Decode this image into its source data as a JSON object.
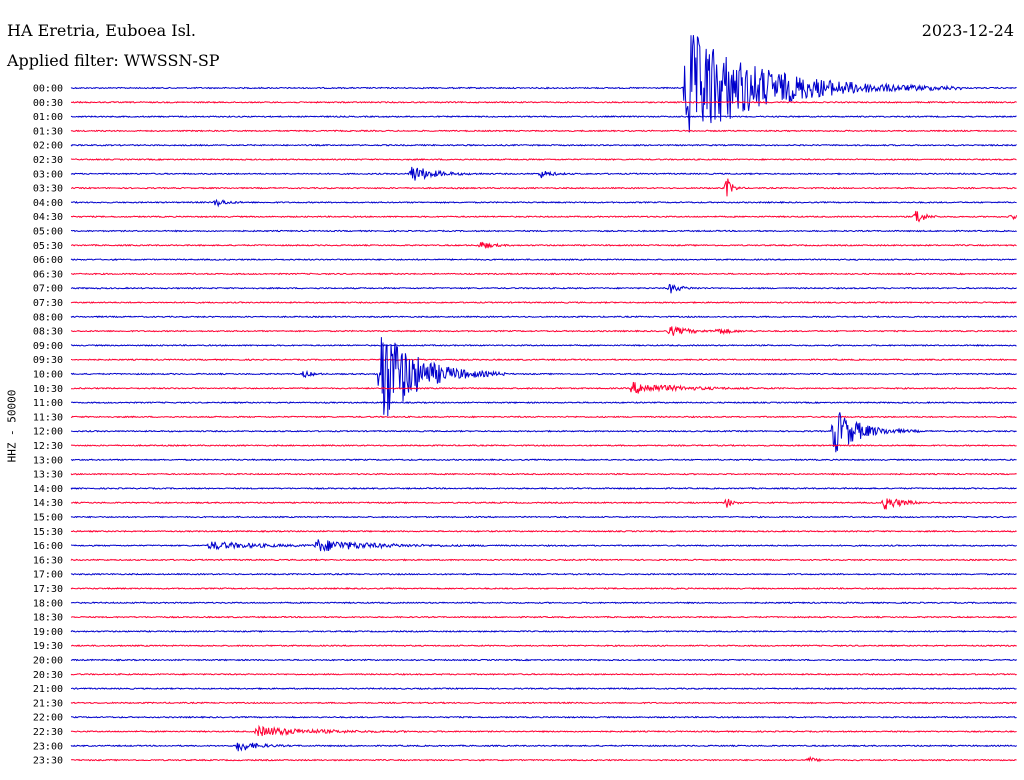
{
  "header": {
    "station": "HA Eretria, Euboea Isl.",
    "filter": "Applied filter: WWSSN-SP",
    "date": "2023-12-24"
  },
  "chart_data": {
    "type": "line",
    "ylabel": "HHZ - 50000",
    "colors": {
      "even_hour": "#0000cc",
      "half_hour": "#ff0033"
    },
    "rows": [
      "00:00",
      "00:30",
      "01:00",
      "01:30",
      "02:00",
      "02:30",
      "03:00",
      "03:30",
      "04:00",
      "04:30",
      "05:00",
      "05:30",
      "06:00",
      "06:30",
      "07:00",
      "07:30",
      "08:00",
      "08:30",
      "09:00",
      "09:30",
      "10:00",
      "10:30",
      "11:00",
      "11:30",
      "12:00",
      "12:30",
      "13:00",
      "13:30",
      "14:00",
      "14:30",
      "15:00",
      "15:30",
      "16:00",
      "16:30",
      "17:00",
      "17:30",
      "18:00",
      "18:30",
      "19:00",
      "19:30",
      "20:00",
      "20:30",
      "21:00",
      "21:30",
      "22:00",
      "22:30",
      "23:00",
      "23:30"
    ],
    "events": [
      {
        "row": 0,
        "minute": 19.5,
        "amp": 60,
        "decay": 2.2
      },
      {
        "row": 6,
        "minute": 10.8,
        "amp": 9,
        "decay": 0.6
      },
      {
        "row": 6,
        "minute": 14.9,
        "amp": 4,
        "decay": 0.3
      },
      {
        "row": 7,
        "minute": 20.8,
        "amp": 11,
        "decay": 0.15
      },
      {
        "row": 8,
        "minute": 4.6,
        "amp": 4,
        "decay": 0.3
      },
      {
        "row": 9,
        "minute": 26.8,
        "amp": 10,
        "decay": 0.2
      },
      {
        "row": 9,
        "minute": 29.8,
        "amp": 3,
        "decay": 0.2
      },
      {
        "row": 11,
        "minute": 13.0,
        "amp": 4,
        "decay": 0.3
      },
      {
        "row": 14,
        "minute": 19.0,
        "amp": 5,
        "decay": 0.3
      },
      {
        "row": 17,
        "minute": 19.0,
        "amp": 5,
        "decay": 0.5
      },
      {
        "row": 17,
        "minute": 20.5,
        "amp": 3,
        "decay": 0.4
      },
      {
        "row": 20,
        "minute": 7.4,
        "amp": 4,
        "decay": 0.2
      },
      {
        "row": 20,
        "minute": 9.8,
        "amp": 58,
        "decay": 1.0
      },
      {
        "row": 21,
        "minute": 17.8,
        "amp": 6,
        "decay": 1.2
      },
      {
        "row": 24,
        "minute": 24.2,
        "amp": 25,
        "decay": 0.7
      },
      {
        "row": 29,
        "minute": 20.8,
        "amp": 5,
        "decay": 0.15
      },
      {
        "row": 29,
        "minute": 25.8,
        "amp": 7,
        "decay": 0.5
      },
      {
        "row": 32,
        "minute": 4.4,
        "amp": 4,
        "decay": 1.4
      },
      {
        "row": 32,
        "minute": 7.8,
        "amp": 6,
        "decay": 1.5
      },
      {
        "row": 45,
        "minute": 5.9,
        "amp": 5,
        "decay": 1.5
      },
      {
        "row": 46,
        "minute": 5.3,
        "amp": 6,
        "decay": 0.5
      },
      {
        "row": 47,
        "minute": 23.4,
        "amp": 3,
        "decay": 0.2
      }
    ]
  }
}
